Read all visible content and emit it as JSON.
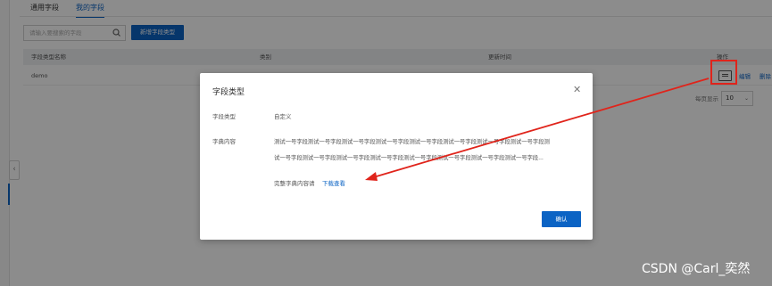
{
  "tabs": [
    {
      "label": "通用字段",
      "active": false
    },
    {
      "label": "我的字段",
      "active": true
    }
  ],
  "search": {
    "placeholder": "请输入要搜索的字段"
  },
  "add_button": "新增字段类型",
  "table": {
    "headers": [
      "字段类型名称",
      "类别",
      "更新时间",
      "操作"
    ],
    "rows": [
      {
        "name": "demo",
        "category": "",
        "updated": "",
        "actions": [
          "编辑",
          "删除"
        ]
      }
    ]
  },
  "pagination": {
    "label": "每页显示",
    "page_size": "10"
  },
  "modal": {
    "title": "字段类型",
    "type_label": "字段类型",
    "type_value": "自定义",
    "dict_label": "字典内容",
    "dict_line1": "测试一号字段测试一号字段测试一号字段测试一号字段测试一号字段测试一号字段测试一号字段测试一号字段测",
    "dict_line2": "试一号字段测试一号字段测试一号字段测试一号字段测试一号字段测试一号字段测试一号字段测试一号字段...",
    "download_prefix": "完整字典内容请",
    "download_link": "下载查看",
    "ok_button": "确认"
  },
  "watermark": "CSDN @Carl_奕然",
  "colors": {
    "accent": "#0b63c4",
    "annotation": "#e0241b"
  },
  "icons": {
    "search": "search-icon",
    "close": "close-icon",
    "detail": "detail-icon",
    "collapse": "chevron-left-icon",
    "dropdown": "chevron-down-icon"
  }
}
